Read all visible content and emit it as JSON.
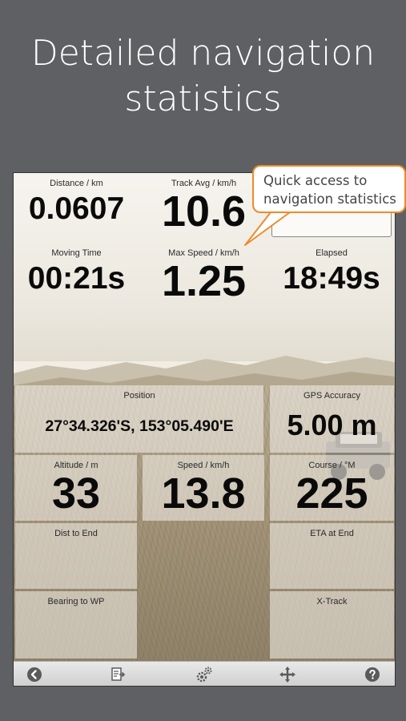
{
  "headline": {
    "line1": "Detailed navigation",
    "line2": "statistics"
  },
  "callout": {
    "line1": "Quick access to",
    "line2": "navigation statistics"
  },
  "stats": {
    "distance": {
      "label": "Distance / km",
      "value": "0.0607"
    },
    "track_avg": {
      "label": "Track Avg / km/h",
      "value": "10.6"
    },
    "moving_time": {
      "label": "Moving Time",
      "value": "00:21s"
    },
    "max_speed": {
      "label": "Max Speed / km/h",
      "value": "1.25"
    },
    "elapsed": {
      "label": "Elapsed",
      "value": "18:49s"
    },
    "position": {
      "label": "Position",
      "value": "27°34.326'S, 153°05.490'E"
    },
    "gps_accuracy": {
      "label": "GPS Accuracy",
      "value": "5.00 m"
    },
    "altitude": {
      "label": "Altitude / m",
      "value": "33"
    },
    "speed": {
      "label": "Speed / km/h",
      "value": "13.8"
    },
    "course": {
      "label": "Course / °M",
      "value": "225"
    },
    "dist_to_end": {
      "label": "Dist to End",
      "value": ""
    },
    "eta_at_end": {
      "label": "ETA at End",
      "value": ""
    },
    "bearing_to_wp": {
      "label": "Bearing to WP",
      "value": ""
    },
    "x_track": {
      "label": "X-Track",
      "value": ""
    }
  },
  "toolbar": {
    "icons": [
      "back-arrow-icon",
      "export-document-icon",
      "settings-gears-icon",
      "move-arrows-icon",
      "help-icon"
    ]
  },
  "colors": {
    "callout_border": "#f08a2a",
    "page_background": "#5f6063"
  }
}
